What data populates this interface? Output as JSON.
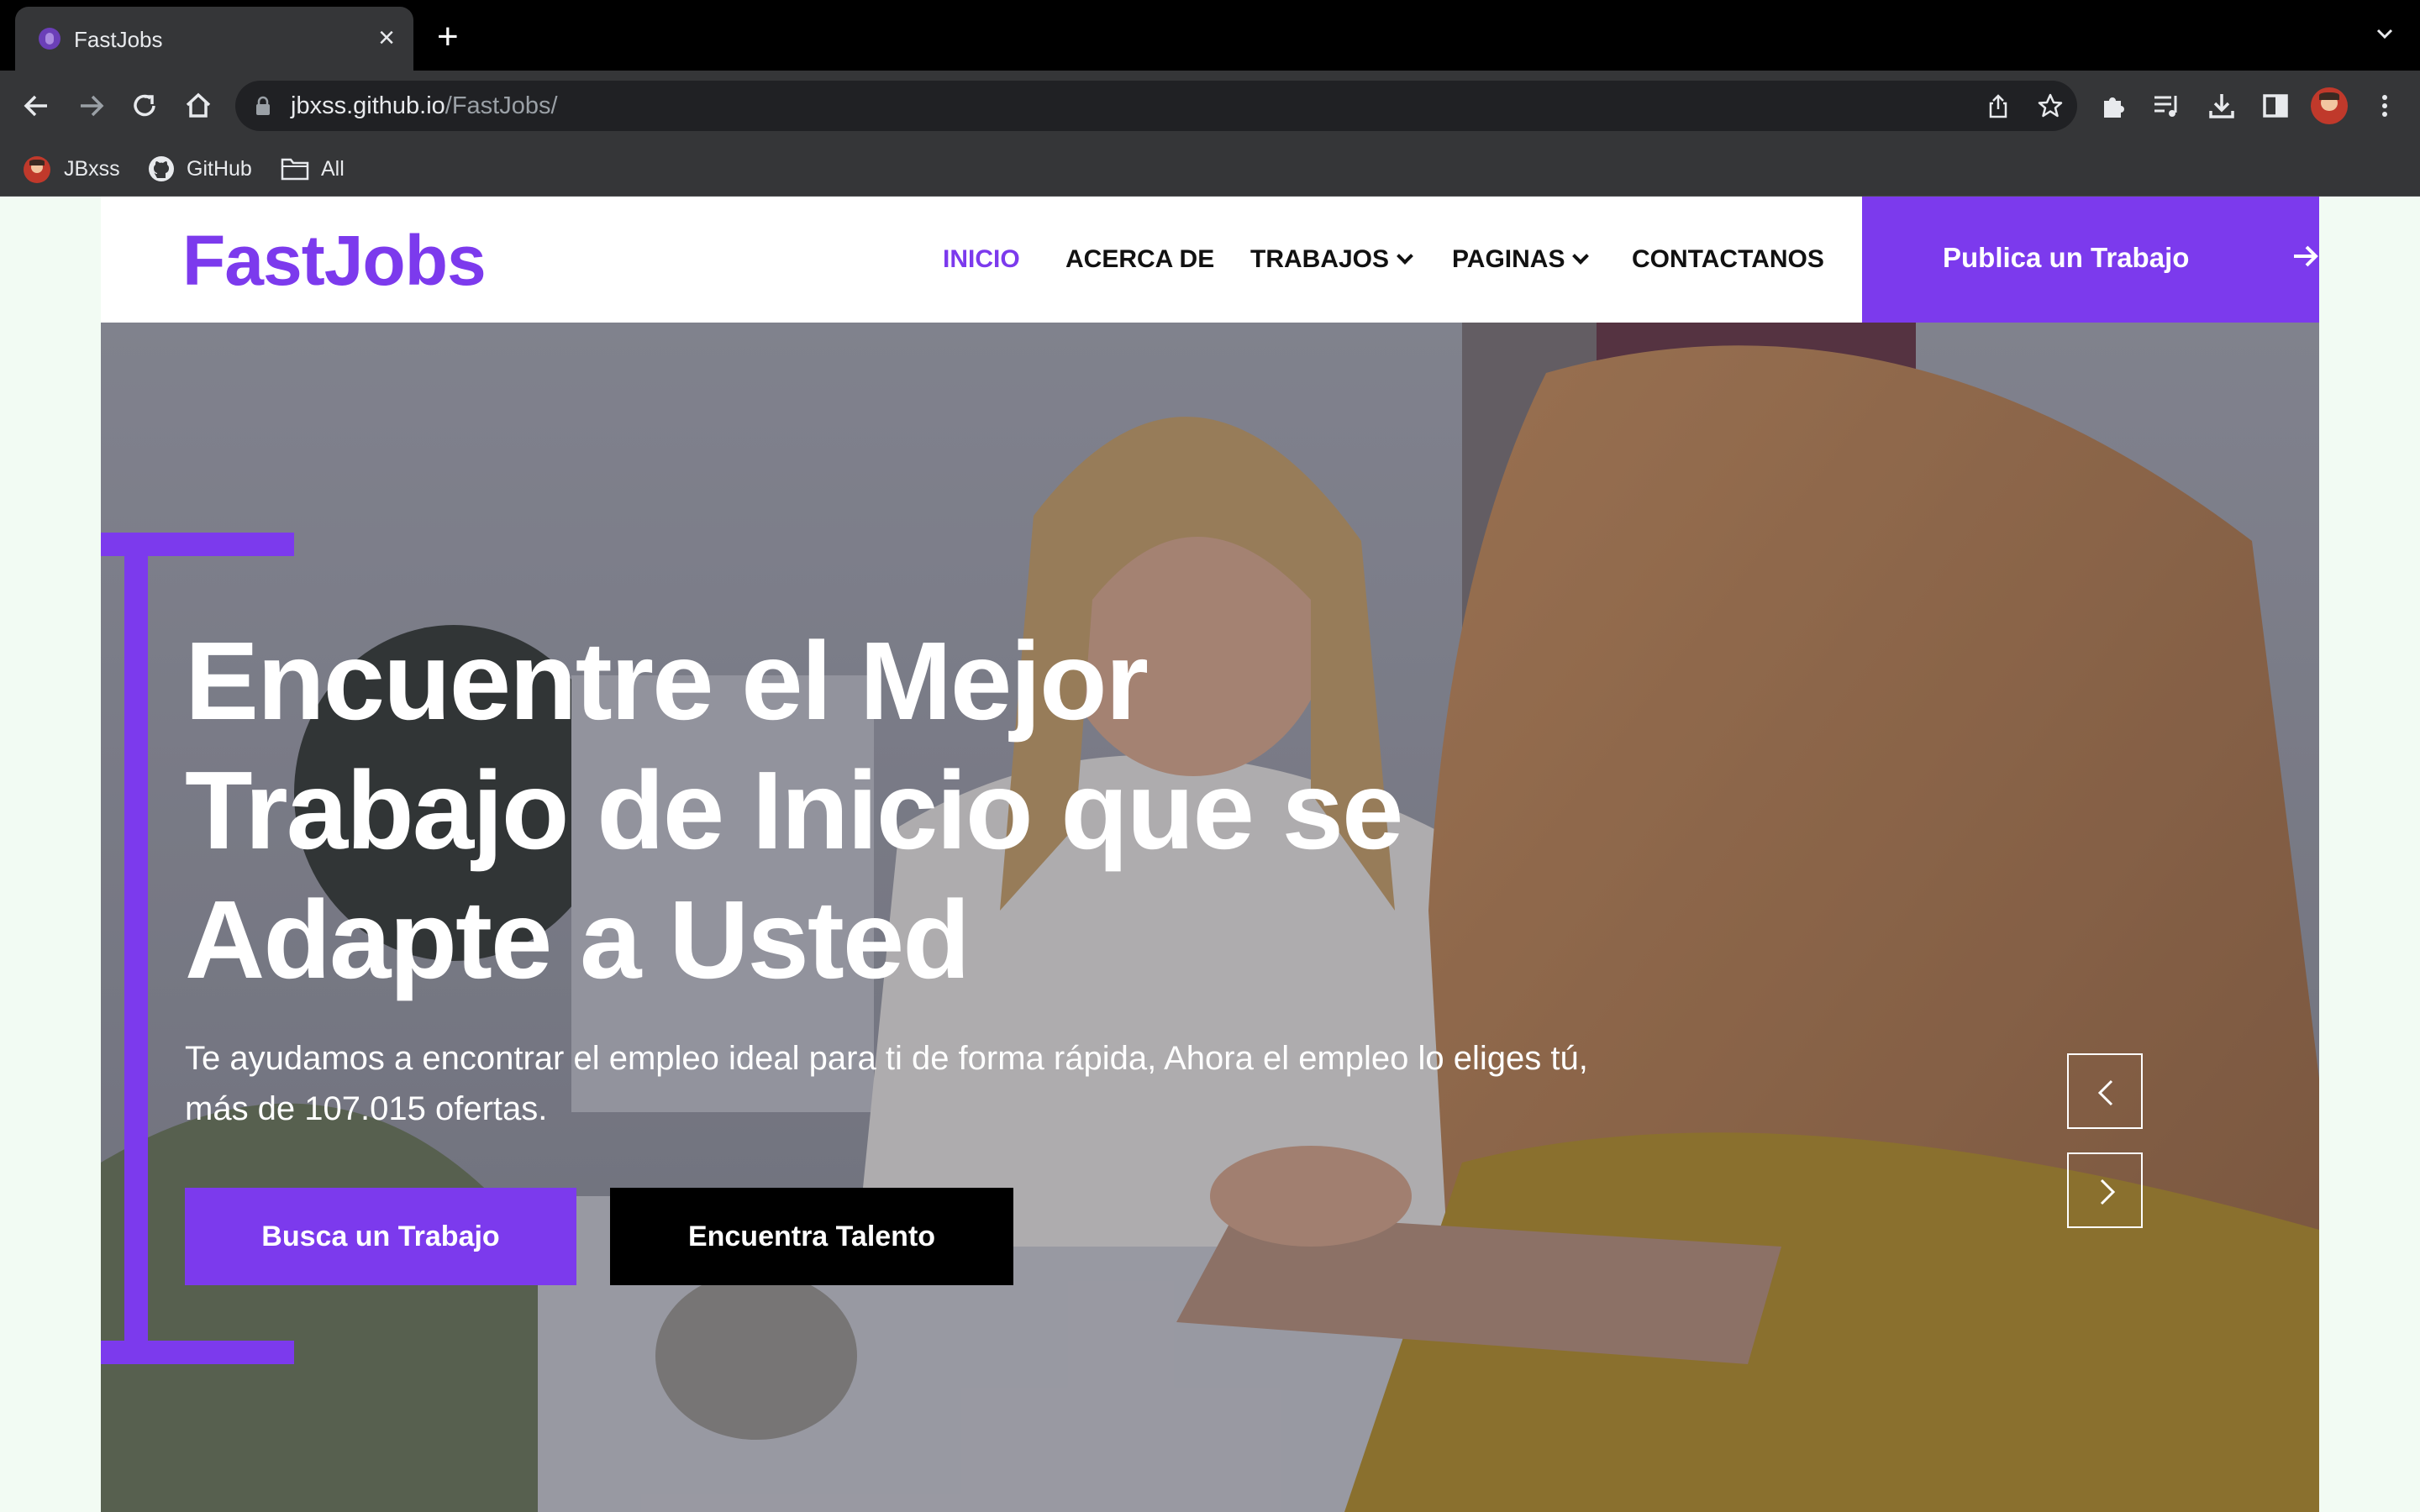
{
  "browser": {
    "tab_title": "FastJobs",
    "url_host": "jbxss.github.io",
    "url_path": "/FastJobs/",
    "bookmarks": [
      {
        "label": "JBxss",
        "icon": "avatar-icon"
      },
      {
        "label": "GitHub",
        "icon": "github-icon"
      },
      {
        "label": "All",
        "icon": "folder-icon"
      }
    ]
  },
  "site": {
    "logo": "FastJobs",
    "nav": [
      {
        "label": "INICIO",
        "active": true
      },
      {
        "label": "ACERCA DE",
        "active": false
      },
      {
        "label": "TRABAJOS",
        "active": false,
        "dropdown": true
      },
      {
        "label": "PAGINAS",
        "active": false,
        "dropdown": true
      },
      {
        "label": "CONTACTANOS",
        "active": false
      }
    ],
    "publish_button": "Publica un Trabajo",
    "accent_color": "#7c3aed"
  },
  "hero": {
    "headline_lines": [
      "Encuentre el Mejor",
      "Trabajo de Inicio que se",
      "Adapte a Usted"
    ],
    "subtext_lines": [
      "Te ayudamos a encontrar el empleo ideal para ti de forma rápida, Ahora el empleo lo eliges tú,",
      "más de 107.015 ofertas."
    ],
    "primary_button": "Busca un Trabajo",
    "secondary_button": "Encuentra Talento"
  }
}
